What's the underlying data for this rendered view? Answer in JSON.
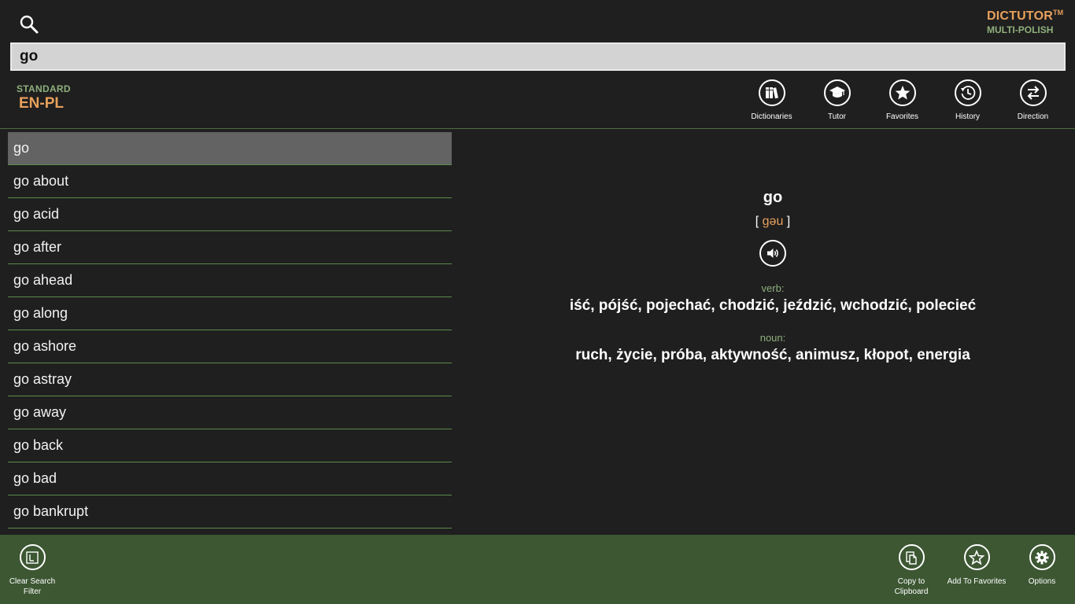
{
  "brand": {
    "name": "DICTUTOR",
    "tm": "TM",
    "edition": "MULTI-POLISH"
  },
  "search": {
    "value": "go",
    "placeholder": ""
  },
  "dictionary": {
    "type": "STANDARD",
    "direction": "EN-PL"
  },
  "toolbar": {
    "dictionaries": "Dictionaries",
    "tutor": "Tutor",
    "favorites": "Favorites",
    "history": "History",
    "direction": "Direction"
  },
  "word_list": [
    "go",
    "go about",
    "go acid",
    "go after",
    "go ahead",
    "go along",
    "go ashore",
    "go astray",
    "go away",
    "go back",
    "go bad",
    "go bankrupt"
  ],
  "entry": {
    "word": "go",
    "bracket_open": "[",
    "pronunciation": "gəu",
    "bracket_close": "]",
    "senses": [
      {
        "pos": "verb:",
        "translations": "iść, pójść, pojechać, chodzić, jeździć, wchodzić, polecieć"
      },
      {
        "pos": "noun:",
        "translations": "ruch, życie, próba, aktywność, animusz, kłopot, energia"
      }
    ]
  },
  "appbar": {
    "clear_filter": "Clear Search Filter",
    "copy": "Copy to Clipboard",
    "add_favorites": "Add To Favorites",
    "options": "Options"
  },
  "colors": {
    "background": "#1f1f1f",
    "accent_orange": "#e8a15c",
    "accent_green": "#8fb07c",
    "appbar": "#3c5732",
    "selected_row": "#636363"
  }
}
